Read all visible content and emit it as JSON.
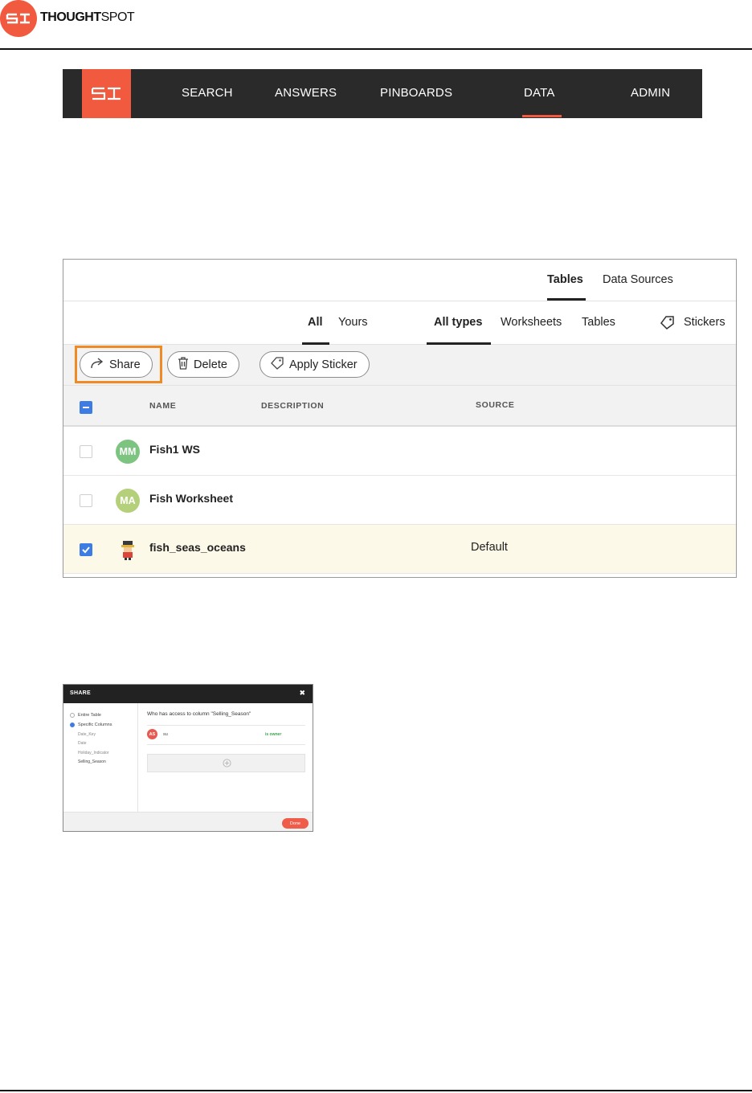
{
  "document": {
    "brand_bold": "THOUGHT",
    "brand_regular": "SPOT"
  },
  "navbar": {
    "items": [
      {
        "label": "SEARCH"
      },
      {
        "label": "ANSWERS"
      },
      {
        "label": "PINBOARDS"
      },
      {
        "label": "DATA",
        "active": true
      },
      {
        "label": "ADMIN"
      }
    ],
    "accent_color": "#f15a3e",
    "background_color": "#2a2a2a"
  },
  "data_panel": {
    "top_tabs": [
      {
        "label": "Tables",
        "active": true
      },
      {
        "label": "Data Sources"
      }
    ],
    "owner_filters": [
      {
        "label": "All",
        "active": true
      },
      {
        "label": "Yours"
      }
    ],
    "type_filters": [
      {
        "label": "All types",
        "active": true
      },
      {
        "label": "Worksheets"
      },
      {
        "label": "Tables"
      }
    ],
    "stickers_label": "Stickers",
    "actions": {
      "share": "Share",
      "delete": "Delete",
      "apply_sticker": "Apply Sticker"
    },
    "highlight_color": "#f08a24",
    "columns": {
      "name": "NAME",
      "description": "DESCRIPTION",
      "source": "SOURCE"
    },
    "rows": [
      {
        "avatar": "MM",
        "avatar_color": "#7cc47f",
        "name": "Fish1 WS",
        "description": "",
        "source": "",
        "checked": false
      },
      {
        "avatar": "MA",
        "avatar_color": "#b5d07a",
        "name": "Fish Worksheet",
        "description": "",
        "source": "",
        "checked": false
      },
      {
        "avatar": "robot-icon",
        "avatar_color": "#ffffff",
        "name": "fish_seas_oceans",
        "description": "",
        "source": "Default",
        "checked": true
      }
    ]
  },
  "share_dialog": {
    "title": "SHARE",
    "options": [
      {
        "label": "Entire Table",
        "selected": false
      },
      {
        "label": "Specific Columns",
        "selected": true
      }
    ],
    "columns": [
      "Date_Key",
      "Date",
      "Holiday_Indicator",
      "Selling_Season"
    ],
    "question": "Who has access to column \"Selling_Season\"",
    "user": {
      "initials": "AS",
      "name": "su",
      "role": "is owner"
    },
    "done_label": "Done"
  }
}
